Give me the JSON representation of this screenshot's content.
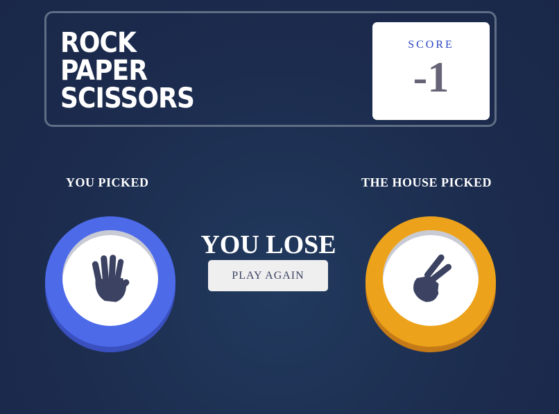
{
  "header": {
    "title_lines": [
      "ROCK",
      "PAPER",
      "SCISSORS"
    ],
    "score_label": "SCORE",
    "score_value": "-1"
  },
  "game": {
    "you_label": "YOU PICKED",
    "house_label": "THE HOUSE PICKED",
    "you_pick": "paper",
    "house_pick": "scissors",
    "result_text": "YOU LOSE",
    "play_again_label": "PLAY AGAIN"
  },
  "colors": {
    "background": "#1f3157",
    "paper_ring": "#4d6ae9",
    "scissors_ring": "#eca21b",
    "icon": "#3b4262",
    "score_label": "#2a45c2",
    "score_value": "#565468"
  },
  "icons": {
    "you_pick_icon": "paper-hand-icon",
    "house_pick_icon": "scissors-hand-icon"
  }
}
